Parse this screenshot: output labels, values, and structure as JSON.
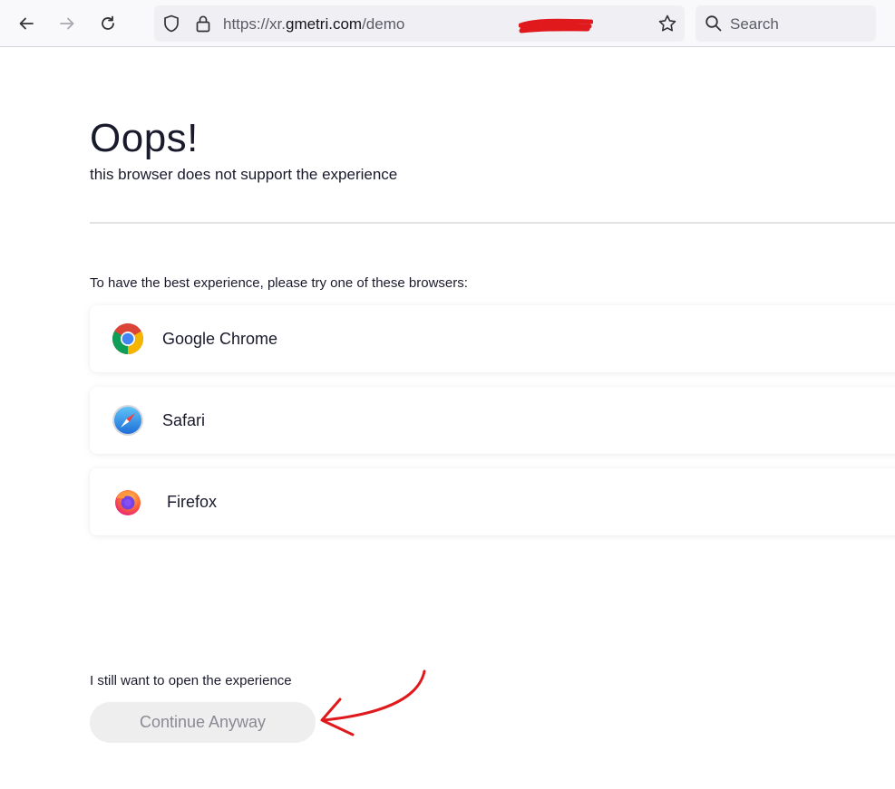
{
  "browser": {
    "url_prefix": "https://xr.",
    "url_host": "gmetri.com",
    "url_suffix": "/demo",
    "search_placeholder": "Search"
  },
  "page": {
    "title": "Oops!",
    "subtitle": "this browser does not support the experience",
    "prompt": "To have the best experience, please try one of these browsers:",
    "browsers": [
      {
        "name": "Google Chrome",
        "icon": "chrome-logo-icon"
      },
      {
        "name": "Safari",
        "icon": "safari-logo-icon"
      },
      {
        "name": "Firefox",
        "icon": "firefox-logo-icon"
      }
    ],
    "still_text": "I still want to open the experience",
    "continue_label": "Continue Anyway"
  },
  "colors": {
    "annotation_red": "#e0191c",
    "button_bg": "#eeeeee",
    "text_dark": "#191a2c"
  }
}
